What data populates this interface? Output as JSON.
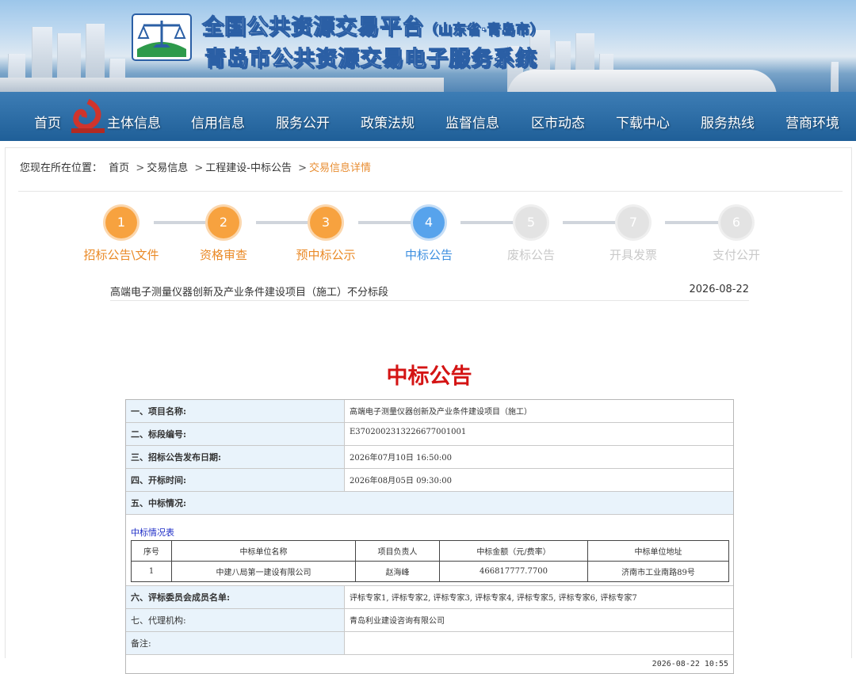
{
  "header": {
    "title_main": "全国公共资源交易平台",
    "title_sub": "（山东省·青岛市）",
    "title_2": "青岛市公共资源交易电子服务系统",
    "logo_icon": "scales-of-justice-logo",
    "colors": {
      "title_stroke": "#2b5fa5",
      "sea": "#2f6a9f"
    }
  },
  "nav": {
    "items": [
      "首页",
      "主体信息",
      "信用信息",
      "服务公开",
      "政策法规",
      "监督信息",
      "区市动态",
      "下载中心",
      "服务热线",
      "营商环境"
    ]
  },
  "breadcrumb": {
    "prefix": "您现在所在位置：",
    "items": [
      "首页",
      "交易信息",
      "工程建设-中标公告"
    ],
    "current": "交易信息详情",
    "separator": ">"
  },
  "steps": [
    {
      "num": "1",
      "label": "招标公告\\文件",
      "state": "done"
    },
    {
      "num": "2",
      "label": "资格审查",
      "state": "done"
    },
    {
      "num": "3",
      "label": "预中标公示",
      "state": "done"
    },
    {
      "num": "4",
      "label": "中标公告",
      "state": "active"
    },
    {
      "num": "5",
      "label": "废标公告",
      "state": "todo"
    },
    {
      "num": "7",
      "label": "开具发票",
      "state": "todo"
    },
    {
      "num": "6",
      "label": "支付公开",
      "state": "todo"
    }
  ],
  "step_colors": {
    "done": "#f7a23f",
    "active": "#57a3ec",
    "todo": "#e3e3e3"
  },
  "project": {
    "name": "高端电子测量仪器创新及产业条件建设项目（施工）不分标段",
    "date": "2026-08-22"
  },
  "doc": {
    "title": "中标公告",
    "title_color": "#d41414",
    "rows": [
      {
        "label": "一、项目名称:",
        "value": "高端电子测量仪器创新及产业条件建设项目（施工）"
      },
      {
        "label": "二、标段编号:",
        "value": "E3702002313226677001001"
      },
      {
        "label": "三、招标公告发布日期:",
        "value": "2026年07月10日 16:50:00"
      },
      {
        "label": "四、开标时间:",
        "value": "2026年08月05日 09:30:00"
      }
    ],
    "section5": "五、中标情况:",
    "bid_table": {
      "title": "中标情况表",
      "headers": [
        "序号",
        "中标单位名称",
        "项目负责人",
        "中标金额（元/费率）",
        "中标单位地址"
      ],
      "rows": [
        [
          "1",
          "中建八局第一建设有限公司",
          "赵海峰",
          "466817777.7700",
          "济南市工业南路89号"
        ]
      ]
    },
    "row6": {
      "label": "六、评标委员会成员名单:",
      "value": "评标专家1, 评标专家2, 评标专家3, 评标专家4, 评标专家5, 评标专家6, 评标专家7"
    },
    "row7": {
      "label": "七、代理机构:",
      "value": "青岛利业建设咨询有限公司"
    },
    "row8": {
      "label": "备注:",
      "value": ""
    },
    "footer_date": "2026-08-22 10:55"
  }
}
